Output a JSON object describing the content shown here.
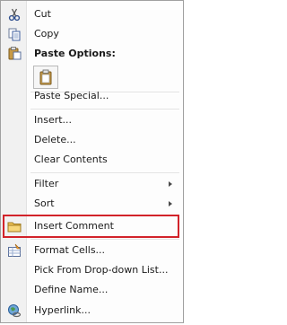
{
  "menu": {
    "items": [
      {
        "id": "cut",
        "label": "Cut",
        "icon": "scissors-icon"
      },
      {
        "id": "copy",
        "label": "Copy",
        "icon": "copy-icon"
      },
      {
        "id": "paste-options",
        "label": "Paste Options:",
        "icon": "clipboard-icon"
      },
      {
        "id": "paste-special",
        "label": "Paste Special..."
      },
      {
        "id": "insert",
        "label": "Insert..."
      },
      {
        "id": "delete",
        "label": "Delete..."
      },
      {
        "id": "clear-contents",
        "label": "Clear Contents"
      },
      {
        "id": "filter",
        "label": "Filter",
        "submenu": true
      },
      {
        "id": "sort",
        "label": "Sort",
        "submenu": true
      },
      {
        "id": "insert-comment",
        "label": "Insert Comment",
        "icon": "comment-icon",
        "highlighted": true
      },
      {
        "id": "format-cells",
        "label": "Format Cells...",
        "icon": "format-cells-icon"
      },
      {
        "id": "pick-from-list",
        "label": "Pick From Drop-down List..."
      },
      {
        "id": "define-name",
        "label": "Define Name..."
      },
      {
        "id": "hyperlink",
        "label": "Hyperlink...",
        "icon": "globe-link-icon"
      }
    ]
  },
  "colors": {
    "highlight_border": "#d2232a",
    "gutter": "#f1f1f1"
  }
}
